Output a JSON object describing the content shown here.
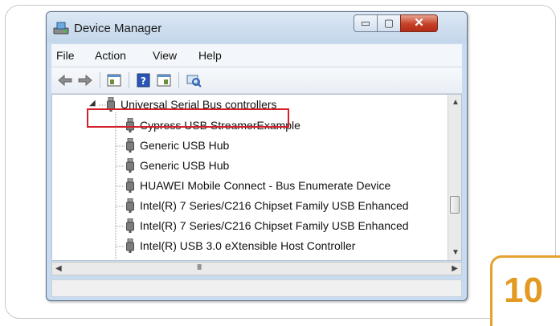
{
  "window": {
    "title": "Device Manager"
  },
  "controls": {
    "minimize": "▭",
    "maximize": "▢",
    "close": "✕"
  },
  "menu": [
    {
      "label": "File"
    },
    {
      "label": "Action"
    },
    {
      "label": "View"
    },
    {
      "label": "Help"
    }
  ],
  "toolbar": {
    "icons": [
      "back-arrow-icon",
      "forward-arrow-icon",
      "properties-icon",
      "help-icon",
      "show-hidden-icon",
      "scan-hardware-icon"
    ]
  },
  "tree": {
    "category": "Universal Serial Bus controllers",
    "devices": [
      {
        "label": "Cypress USB StreamerExample"
      },
      {
        "label": "Generic USB Hub"
      },
      {
        "label": "Generic USB Hub"
      },
      {
        "label": "HUAWEI Mobile Connect - Bus Enumerate Device"
      },
      {
        "label": "Intel(R) 7 Series/C216 Chipset Family USB Enhanced"
      },
      {
        "label": "Intel(R) 7 Series/C216 Chipset Family USB Enhanced"
      },
      {
        "label": "Intel(R) USB 3.0 eXtensible Host Controller"
      }
    ]
  },
  "hscroll": {
    "grip": "III"
  },
  "step_badge": "10",
  "colors": {
    "highlight": "#d4202b",
    "badge": "#e39a23"
  }
}
